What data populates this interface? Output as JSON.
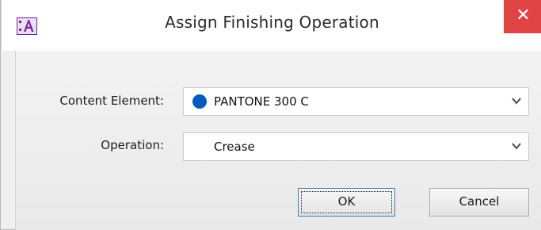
{
  "window": {
    "title": "Assign Finishing Operation",
    "close_glyph": "✕",
    "app_icon": "app-icon",
    "app_icon_color": "#7a1fa2"
  },
  "form": {
    "content_element": {
      "label": "Content Element:",
      "value": "PANTONE 300 C",
      "swatch_color": "#005bbb"
    },
    "operation": {
      "label": "Operation:",
      "value": "Crease"
    }
  },
  "buttons": {
    "ok_label": "OK",
    "cancel_label": "Cancel"
  }
}
